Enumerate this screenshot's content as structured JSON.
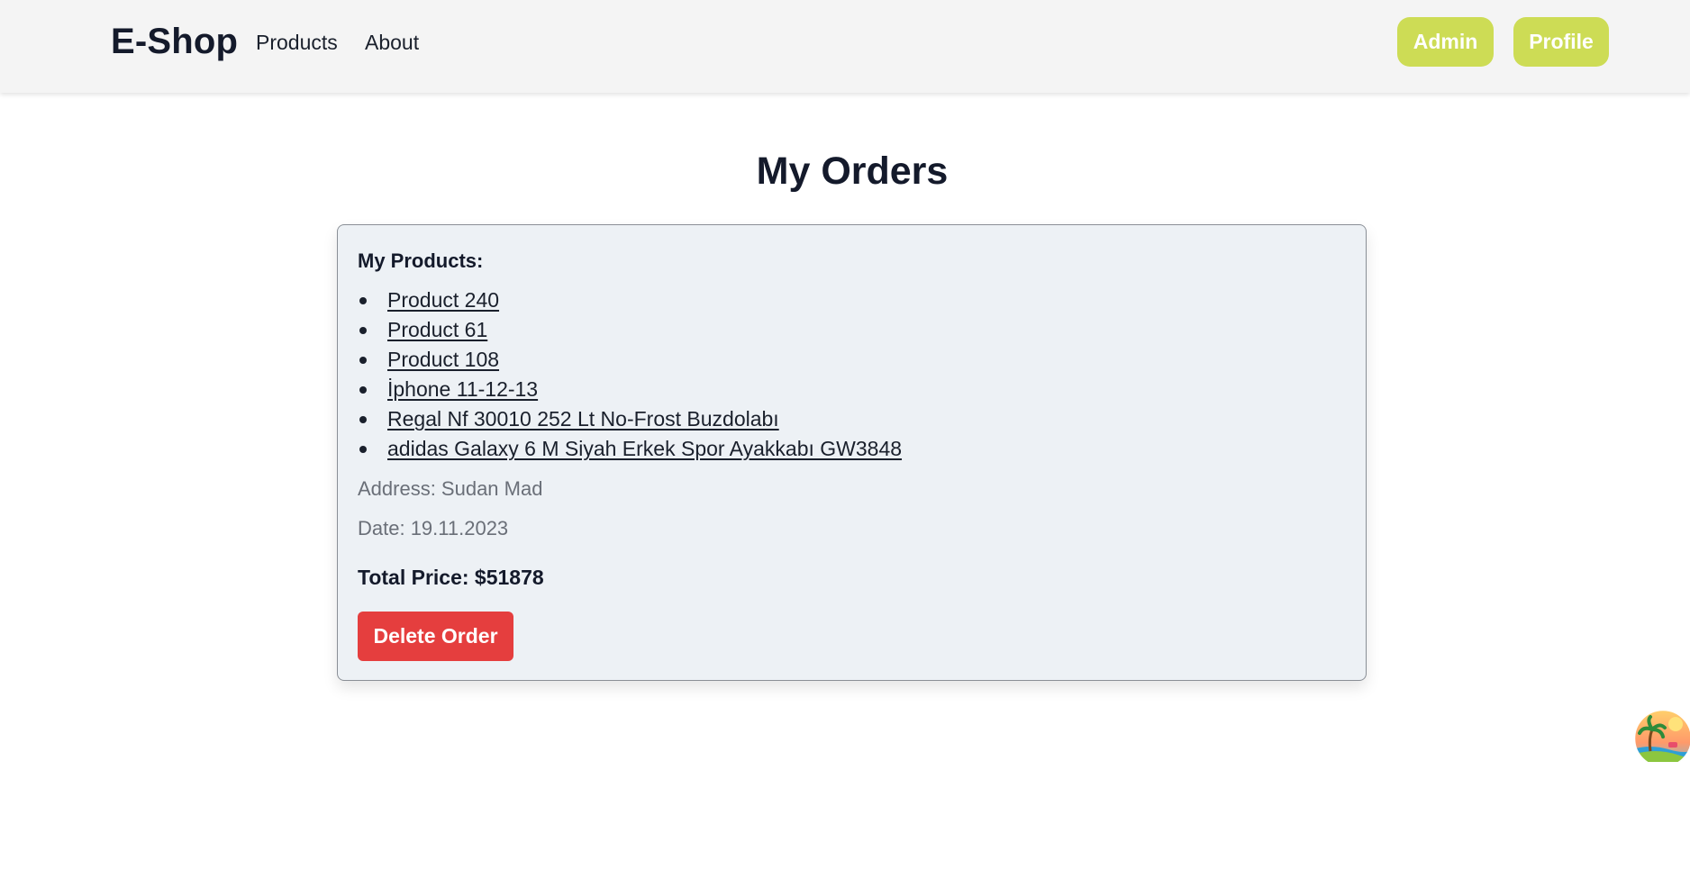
{
  "navbar": {
    "brand": "E-Shop",
    "links": [
      "Products",
      "About"
    ],
    "buttons": [
      "Admin",
      "Profile"
    ],
    "accent_color": "#cddc55",
    "background_color": "#f4f4f4"
  },
  "page": {
    "title": "My Orders"
  },
  "order": {
    "products_heading": "My Products:",
    "products": [
      "Product 240",
      "Product 61",
      "Product 108",
      "İphone 11-12-13",
      "Regal Nf 30010 252 Lt No-Frost Buzdolabı",
      "adidas Galaxy 6 M Siyah Erkek Spor Ayakkabı GW3848"
    ],
    "address": "Address: Sudan Mad",
    "date": "Date: 19.11.2023",
    "total_price": "Total Price: $51878",
    "delete_label": "Delete Order",
    "card_color": "#edf1f5",
    "delete_color": "#e53e3e"
  },
  "floating_widget": {
    "icon": "beach-avatar-icon"
  }
}
